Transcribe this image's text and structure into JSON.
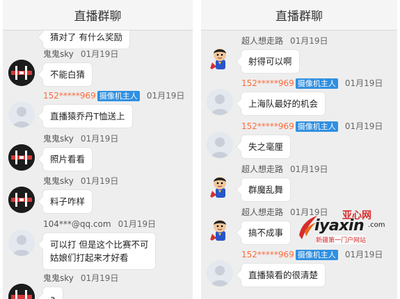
{
  "left": {
    "title": "直播群聊",
    "partial_top_text": "猜对了 有什么奖励",
    "messages": [
      {
        "nick": "鬼鬼sky",
        "time": "01月19日",
        "text": "不能白猜"
      },
      {
        "nick": "152*****969",
        "badge": "摄像机主人",
        "time": "01月19日",
        "text": "直播猿乔丹T恤送上"
      },
      {
        "nick": "鬼鬼sky",
        "time": "01月19日",
        "text": "照片看看"
      },
      {
        "nick": "鬼鬼sky",
        "time": "01月19日",
        "text": "料子咋样"
      },
      {
        "nick": "104***@qq.com",
        "time": "01月19日",
        "text_line1": "可以打 但是这个比赛不可",
        "text_line2": "姑娘们打起来才好看"
      },
      {
        "nick": "鬼鬼sky",
        "time": "01月19日",
        "text": "a"
      }
    ]
  },
  "right": {
    "title": "直播群聊",
    "messages": [
      {
        "nick": "超人想走路",
        "time": "01月19日",
        "text": "射得可以啊"
      },
      {
        "nick": "152*****969",
        "badge": "摄像机主人",
        "time": "01月19日",
        "text": "上海队最好的机会"
      },
      {
        "nick": "152*****969",
        "badge": "摄像机主人",
        "time": "01月19日",
        "text": "失之毫厘"
      },
      {
        "nick": "超人想走路",
        "time": "01月19日",
        "text": "群魔乱舞"
      },
      {
        "nick": "超人想走路",
        "time": "01月19日",
        "text": "搞不成事"
      },
      {
        "nick": "152*****969",
        "badge": "摄像机主人",
        "time": "01月19日",
        "text": "直播猿看的很清楚"
      }
    ]
  },
  "watermark": {
    "top": "亚心网",
    "main": "iyaxin",
    "dotcom": ".com",
    "sub": "新疆第一门户网站"
  },
  "colors": {
    "nick_owner": "#ff6a3a",
    "badge_bg": "#2f8fe0",
    "panel_bg": "#eeeeee",
    "brand_red": "#d72c2c"
  }
}
